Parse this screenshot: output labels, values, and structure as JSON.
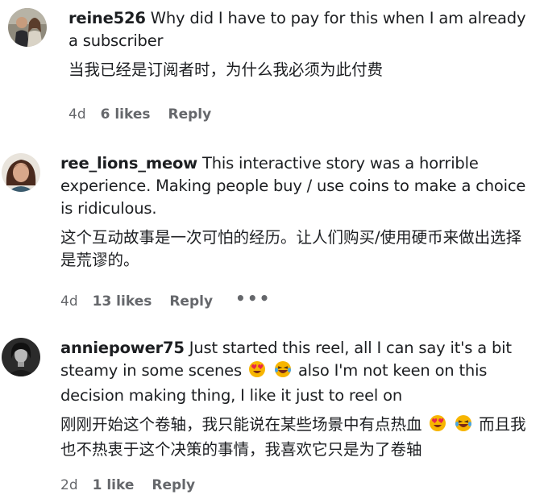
{
  "comments": [
    {
      "username": "reine526",
      "text": "Why did I have to pay for this when I am already a subscriber",
      "translation": "当我已经是订阅者时，为什么我必须为此付费",
      "time": "4d",
      "likes": "6 likes",
      "reply": "Reply"
    },
    {
      "username": "ree_lions_meow",
      "text": "This interactive story was a horrible experience. Making people buy / use coins to make a choice is ridiculous.",
      "translation": "这个互动故事是一次可怕的经历。让人们购买/使用硬币来做出选择是荒谬的。",
      "time": "4d",
      "likes": "13 likes",
      "reply": "Reply",
      "more": "•••"
    },
    {
      "username": "anniepower75",
      "text_before_emoji": "Just started this reel, all I can say it's a bit steamy in some scenes",
      "text_after_emoji": "also I'm not keen on this decision making thing, I like it just to reel on",
      "translation_before_emoji": "刚刚开始这个卷轴，我只能说在某些场景中有点热血",
      "translation_after_emoji": "而且我也不热衷于这个决策的事情，我喜欢它只是为了卷轴",
      "emojis": [
        "heart-eyes-emoji",
        "laughing-tears-emoji"
      ],
      "time": "2d",
      "likes": "1 like",
      "reply": "Reply"
    }
  ],
  "colors": {
    "text": "#1c1e21",
    "meta": "#65676b",
    "emoji_face": "#f7b500"
  }
}
